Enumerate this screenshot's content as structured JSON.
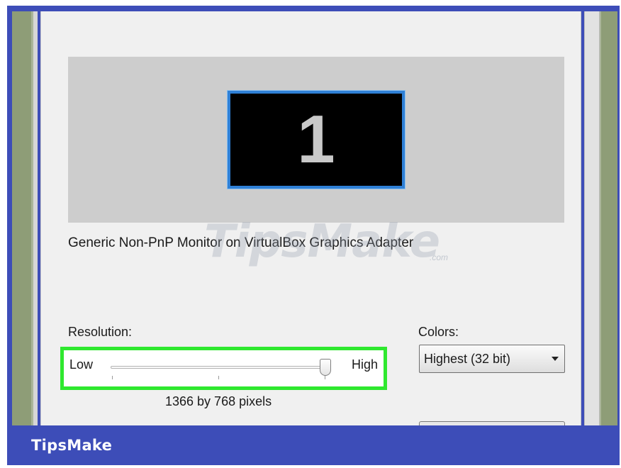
{
  "monitor": {
    "number": "1"
  },
  "adapter_label": "Generic Non-PnP Monitor on VirtualBox Graphics Adapter",
  "resolution": {
    "label": "Resolution:",
    "low_label": "Low",
    "high_label": "High",
    "value_text": "1366 by 768 pixels"
  },
  "colors": {
    "label": "Colors:",
    "selected": "Highest (32 bit)"
  },
  "watermark": {
    "text": "TipsMake",
    "suffix": ".com"
  },
  "footer": {
    "brand": "TipsMake"
  },
  "theme": {
    "highlight": "#2fe82f",
    "brand_bar": "#3d4db8",
    "monitor_border": "#2f80d6"
  }
}
